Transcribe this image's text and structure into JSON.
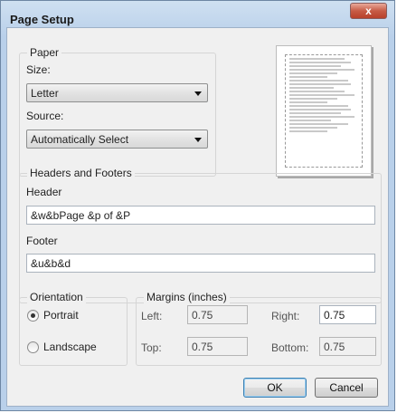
{
  "window": {
    "title": "Page Setup",
    "close_glyph": "x"
  },
  "paper": {
    "legend": "Paper",
    "size_label": "Size:",
    "size_value": "Letter",
    "source_label": "Source:",
    "source_value": "Automatically Select"
  },
  "headers_footers": {
    "legend": "Headers and Footers",
    "header_label": "Header",
    "header_value": "&w&bPage &p of &P",
    "footer_label": "Footer",
    "footer_value": "&u&b&d"
  },
  "orientation": {
    "legend": "Orientation",
    "portrait_label": "Portrait",
    "landscape_label": "Landscape",
    "selected": "Portrait"
  },
  "margins": {
    "legend": "Margins (inches)",
    "left_label": "Left:",
    "left_value": "0.75",
    "right_label": "Right:",
    "right_value": "0.75",
    "top_label": "Top:",
    "top_value": "0.75",
    "bottom_label": "Bottom:",
    "bottom_value": "0.75"
  },
  "buttons": {
    "ok_label": "OK",
    "cancel_label": "Cancel"
  },
  "colors": {
    "window_frame": "#b9d0ea",
    "dialog_bg": "#f0f0f0",
    "close_button": "#c75c46",
    "default_button_border": "#3c7fb1"
  }
}
